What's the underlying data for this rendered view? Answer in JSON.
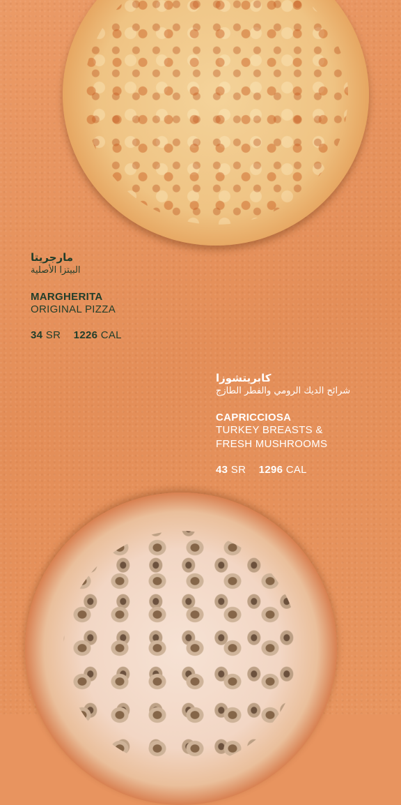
{
  "items": [
    {
      "arabic_name": "مارجريتا",
      "arabic_desc": "البيتزا الأصلية",
      "name": "MARGHERITA",
      "desc_lines": [
        "ORIGINAL PIZZA"
      ],
      "price_value": "34",
      "price_unit": "SR",
      "cal_value": "1226",
      "cal_unit": "CAL"
    },
    {
      "arabic_name": "كابريتشوزا",
      "arabic_desc": "شرائح الديك الرومي والفطر الطازج",
      "name": "CAPRICCIOSA",
      "desc_lines": [
        "TURKEY BREASTS &",
        "FRESH MUSHROOMS"
      ],
      "price_value": "43",
      "price_unit": "SR",
      "cal_value": "1296",
      "cal_unit": "CAL"
    }
  ],
  "colors": {
    "background": "#e8945f",
    "item1_text": "#1f3d2a",
    "item2_text": "#ffffff"
  }
}
